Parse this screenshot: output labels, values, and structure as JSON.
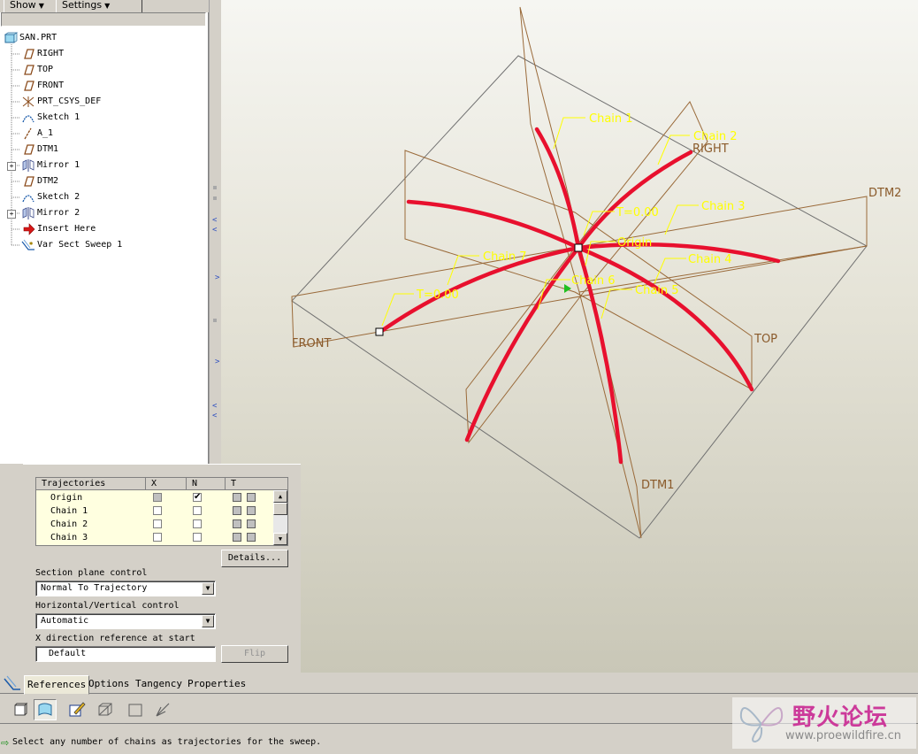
{
  "toolbar": {
    "show_label": "Show",
    "settings_label": "Settings"
  },
  "model_tree": {
    "items": [
      {
        "label": "SAN.PRT",
        "icon": "part-icon"
      },
      {
        "label": "RIGHT",
        "icon": "datum-plane-icon"
      },
      {
        "label": "TOP",
        "icon": "datum-plane-icon"
      },
      {
        "label": "FRONT",
        "icon": "datum-plane-icon"
      },
      {
        "label": "PRT_CSYS_DEF",
        "icon": "csys-icon"
      },
      {
        "label": "Sketch 1",
        "icon": "sketch-icon"
      },
      {
        "label": "A_1",
        "icon": "axis-icon"
      },
      {
        "label": "DTM1",
        "icon": "datum-plane-icon"
      },
      {
        "label": "Mirror 1",
        "icon": "mirror-icon"
      },
      {
        "label": "DTM2",
        "icon": "datum-plane-icon"
      },
      {
        "label": "Sketch 2",
        "icon": "sketch-icon"
      },
      {
        "label": "Mirror 2",
        "icon": "mirror-icon"
      },
      {
        "label": "Insert Here",
        "icon": "insert-arrow-icon"
      },
      {
        "label": "Var Sect Sweep 1",
        "icon": "sweep-icon"
      }
    ]
  },
  "viewport": {
    "planes": {
      "right": "RIGHT",
      "top": "TOP",
      "front": "FRONT",
      "dtm1": "DTM1",
      "dtm2": "DTM2"
    },
    "chain_labels": [
      "Chain 1",
      "Chain 2",
      "Chain 3",
      "Chain 4",
      "Chain 5",
      "Chain 6",
      "Chain 7"
    ],
    "origin_label": "Origin",
    "t_label_center": "T=0.00",
    "t_label_left": "T=0.00"
  },
  "references": {
    "table": {
      "headers": [
        "Trajectories",
        "X",
        "N",
        "T"
      ],
      "rows": [
        {
          "name": "Origin",
          "x": false,
          "n": true
        },
        {
          "name": "Chain 1",
          "x": false,
          "n": false
        },
        {
          "name": "Chain 2",
          "x": false,
          "n": false
        },
        {
          "name": "Chain 3",
          "x": false,
          "n": false
        }
      ],
      "checkmark": "✔"
    },
    "details_label": "Details...",
    "section_plane": {
      "label": "Section plane control",
      "value": "Normal To Trajectory"
    },
    "hv_control": {
      "label": "Horizontal/Vertical control",
      "value": "Automatic"
    },
    "x_dir": {
      "label": "X direction reference at start",
      "value": "Default",
      "flip_label": "Flip"
    }
  },
  "tabs": [
    "References",
    "Options",
    "Tangency",
    "Properties"
  ],
  "status": {
    "message": "Select any number of chains as trajectories for the sweep."
  },
  "watermark": {
    "title": "野火论坛",
    "url": "www.proewildfire.cn"
  },
  "colors": {
    "curve": "#e8102e",
    "label": "#ffff00",
    "datum": "#8a5a2a"
  }
}
